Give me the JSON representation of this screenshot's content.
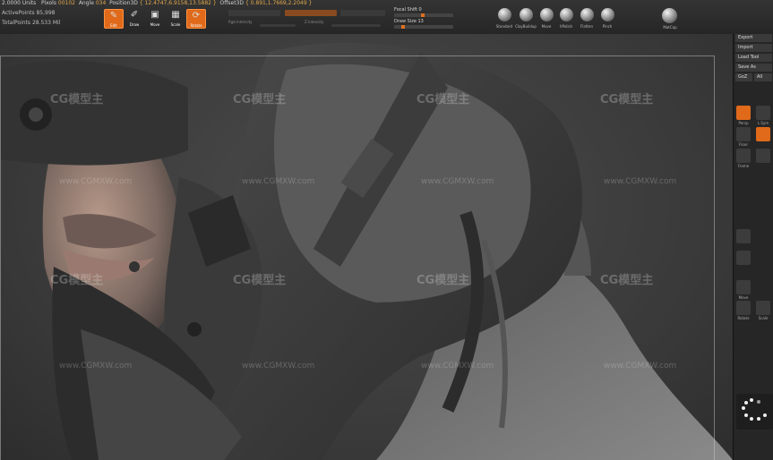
{
  "topbar": {
    "units": "2.0000 Units",
    "pixols_label": "Pixols",
    "pixols_value": "00102",
    "angle_label": "Angle",
    "angle_value": "034",
    "position_label": "Position3D",
    "position_value": "{ 12.4747,6.9158,13.5882 }",
    "offset_label": "Offset3D",
    "offset_value": "{ 0.891,1.7669,2.2049 }",
    "active_points": "ActivePoints 85,998",
    "total_points": "TotalPoints 28.533 Mil",
    "tools": [
      {
        "label": "Edit",
        "icon": "edit-icon",
        "active": true
      },
      {
        "label": "Draw",
        "icon": "draw-icon",
        "active": false
      },
      {
        "label": "Move",
        "icon": "move-icon",
        "active": false
      },
      {
        "label": "Scale",
        "icon": "scale-icon",
        "active": false
      },
      {
        "label": "Rotate",
        "icon": "rotate-icon",
        "active": true
      }
    ],
    "rgb_intensity": "Rgb Intensity",
    "z_intensity": "Z Intensity",
    "focal_shift": "Focal Shift 0",
    "draw_size": "Draw Size 13",
    "brushes": [
      "Standard",
      "ClayBuildup",
      "Move",
      "hPolish",
      "Flatten",
      "Pinch"
    ],
    "material": "MatCap"
  },
  "right_panel": {
    "menu": [
      "Export",
      "Import",
      "Load Tool",
      "Save As",
      "GoZ",
      "All"
    ],
    "buttons": [
      "Persp",
      "L.Sym",
      "Floor",
      "Frame",
      "Move",
      "Rotate",
      "Scale",
      "Zoom"
    ]
  },
  "watermarks": {
    "logo": "CG模型主",
    "url": "www.CGMXW.com"
  },
  "colors": {
    "accent": "#e06a1a",
    "panel": "#262626",
    "viewport": "#404040"
  }
}
